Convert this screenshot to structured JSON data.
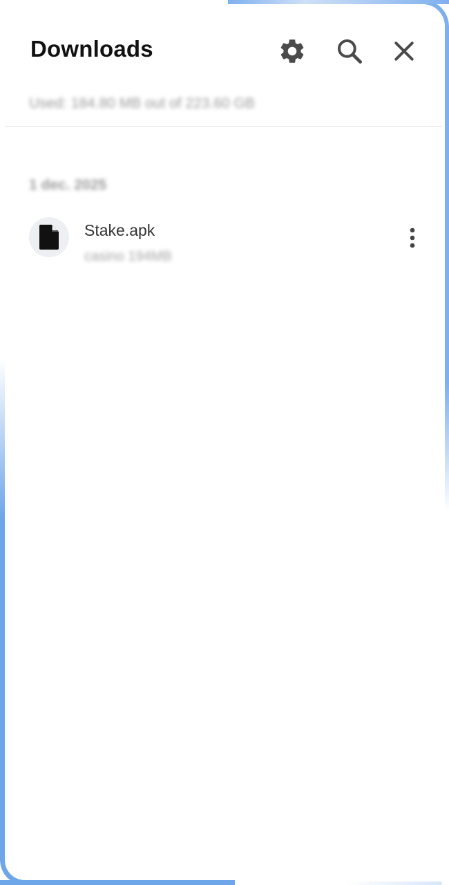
{
  "header": {
    "title": "Downloads",
    "icons": {
      "settings": "gear-icon",
      "search": "search-icon",
      "close": "close-icon"
    }
  },
  "storage": {
    "text": "Used: 184.80 MB out of 223.60 GB"
  },
  "sections": [
    {
      "date": "1 dec. 2025",
      "files": [
        {
          "name": "Stake.apk",
          "meta": "casino 194MB",
          "icon": "file-icon",
          "menu_icon": "more-vertical-icon"
        }
      ]
    }
  ],
  "colors": {
    "title": "#111111",
    "icon": "#4a4a4a",
    "border_accent": "#6ea6ea",
    "thumb_bg": "#eeeff3"
  }
}
